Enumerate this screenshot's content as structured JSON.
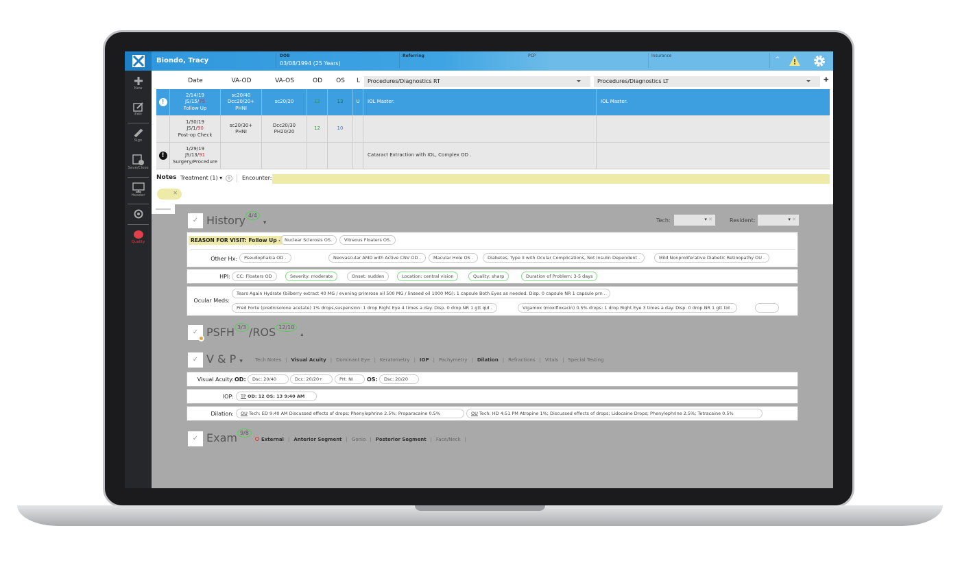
{
  "header": {
    "patient_name": "Biondo, Tracy",
    "dob_label": "DOB",
    "dob_value": "03/08/1994 (25 Years)",
    "referring_label": "Referring",
    "pcp_label": "PCP",
    "insurance_label": "Insurance"
  },
  "sidebar": {
    "items": [
      {
        "label": "New",
        "icon": "plus-icon"
      },
      {
        "label": "Edit",
        "icon": "edit-icon"
      },
      {
        "label": "Sign",
        "icon": "pencil-icon"
      },
      {
        "label": "Save/Close",
        "icon": "save-icon"
      },
      {
        "label": "Header",
        "icon": "monitor-icon"
      },
      {
        "label": "",
        "icon": "compass-icon"
      },
      {
        "label": "Quality",
        "icon": "brain-icon"
      }
    ]
  },
  "encounters": {
    "columns": [
      "Date",
      "VA-OD",
      "VA-OS",
      "OD",
      "OS",
      "L"
    ],
    "proc_rt": "Procedures/Diagnostics RT",
    "proc_lt": "Procedures/Diagnostics LT",
    "rows": [
      {
        "date": "2/14/19",
        "code": "JS/15/",
        "code_num": "75",
        "type": "Follow Up",
        "va_od": "sc20/40 Dcc20/20+ PHNI",
        "va_os": "sc20/20",
        "od": "12",
        "os": "13",
        "l": "U",
        "rt": "IOL Master.",
        "lt": "IOL Master.",
        "alert": true,
        "selected": true
      },
      {
        "date": "1/30/19",
        "code": "JS/1/",
        "code_num": "90",
        "type": "Post-op Check",
        "va_od": "sc20/30+ PHNI",
        "va_os": "Dcc20/30 PH20/20",
        "od": "12",
        "os": "10",
        "l": "",
        "rt": "",
        "lt": "",
        "alert": false,
        "selected": false
      },
      {
        "date": "1/29/19",
        "code": "JS/13/",
        "code_num": "91",
        "type": "Surgery/Procedure",
        "va_od": "",
        "va_os": "",
        "od": "",
        "os": "",
        "l": "",
        "rt": "Cataract Extraction with IOL, Complex OD .",
        "lt": "",
        "alert": true,
        "selected": false
      }
    ]
  },
  "notes": {
    "label": "Notes",
    "treatment": "Treatment (1)",
    "encounter_label": "Encounter:",
    "encounter_value": ""
  },
  "history": {
    "title": "History",
    "badge": "4/4",
    "tech_label": "Tech:",
    "resident_label": "Resident:",
    "reason": "REASON FOR VISIT: Follow Up -",
    "reason_tags": [
      "Nuclear Sclerosis OS.",
      "Vitreous Floaters OS."
    ],
    "other_hx_label": "Other Hx:",
    "other_hx": [
      "Pseudophakia OD .",
      "Neovascular AMD with Active CNV OD .",
      "Macular Hole OS .",
      "Diabetes, Type II with Ocular Complications, Not Insulin Dependent .",
      "Mild Nonproliferative Diabetic Retinopathy OU ."
    ],
    "hpi_label": "HPI:",
    "hpi": [
      "CC: Floaters OD",
      "Severity: moderate",
      "Onset: sudden",
      "Location: central vision",
      "Quality: sharp",
      "Duration of Problem: 3-5 days"
    ],
    "meds_label": "Ocular Meds:",
    "meds": [
      "Tears Again Hydrate (bilberry extract 40 MG / evening primrose oil 500 MG / linseed oil 1000 MG): 1 capsule Both Eyes as needed. Disp. 0 capsule NR 1 capsule prn .",
      "Pred Forte (prednisolone acetate) 1% drops,suspension: 1 drop Right Eye 4 times a day. Disp. 0 drop NR 1 gtt qid .",
      "Vigamox (moxifloxacin) 0.5% drops: 1 drop Right Eye 3 times a day. Disp. 0 drop NR 1 gtt tid ."
    ]
  },
  "psfh": {
    "title1": "PSFH",
    "badge1": "3/3",
    "title2": "/ROS",
    "badge2": "12/10"
  },
  "vp": {
    "title": "V & P",
    "tabs": [
      "Tech Notes",
      "Visual Acuity",
      "Dominant Eye",
      "Keratometry",
      "IOP",
      "Pachymetry",
      "Dilation",
      "Refractions",
      "Vitals",
      "Special Testing"
    ],
    "va_label": "Visual Acuity:",
    "od_label": "OD:",
    "os_label": "OS:",
    "va_tags": [
      "Dsc: 20/40",
      "Dcc: 20/20+",
      "PH: NI"
    ],
    "va_os_tag": "Dsc: 20/20",
    "iop_label": "IOP:",
    "iop_prefix": "TP",
    "iop_value": "OD: 12  OS: 13  9:40 AM",
    "dilation_label": "Dilation:",
    "dilation_prefix": "OU",
    "dilation": [
      "Tech: ED 9:40 AM Discussed effects of drops; Phenylephrine 2.5%; Proparacaine 0.5%",
      "Tech: HD 4:51 PM Atropine 1%; Discussed effects of drops; Lidocaine Drops; Phenylephrine 2.5%; Tetracaine 0.5%"
    ]
  },
  "exam": {
    "title": "Exam",
    "badge": "9/8",
    "tabs": [
      "External",
      "Anterior Segment",
      "Gonio",
      "Posterior Segment",
      "Face/Neck"
    ]
  },
  "colors": {
    "header_blue": "#3fa4e3",
    "selected_row": "#3d9fe0",
    "quality_red": "#e0404a",
    "badge_green": "#55cc55"
  }
}
